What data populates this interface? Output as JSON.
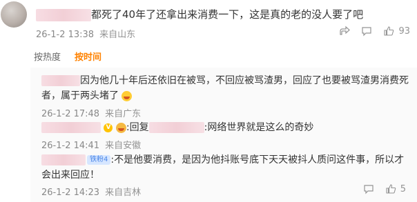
{
  "main_comment": {
    "text": "都死了40年了还拿出来消费一下，这是真的老的没人要了吧",
    "time": "26-1-2 13:38",
    "location": "来自山东",
    "like_count": "93"
  },
  "sort_tabs": {
    "by_hot": "按热度",
    "by_time": "按时间"
  },
  "replies": [
    {
      "line1": "因为他几十年后还依旧在被骂，不回应被骂渣男，回应了也要被骂渣男消费死",
      "line2": "者，属于两头堵了",
      "time": "26-1-2 17:48",
      "location": "来自广东"
    },
    {
      "badge": "V",
      "reply_label": ":回复",
      "text": ":网络世界就是这么的奇妙",
      "time": "26-1-2 14:41",
      "location": "来自安徽"
    },
    {
      "badge": "铁粉4",
      "line1": ":不是他要消费，是因为他抖账号底下天天被抖人质问这件事，所以才",
      "line2": "会出来回应！",
      "time": "26-1-2 14:23",
      "location": "来自吉林",
      "like_count": "5"
    }
  ]
}
